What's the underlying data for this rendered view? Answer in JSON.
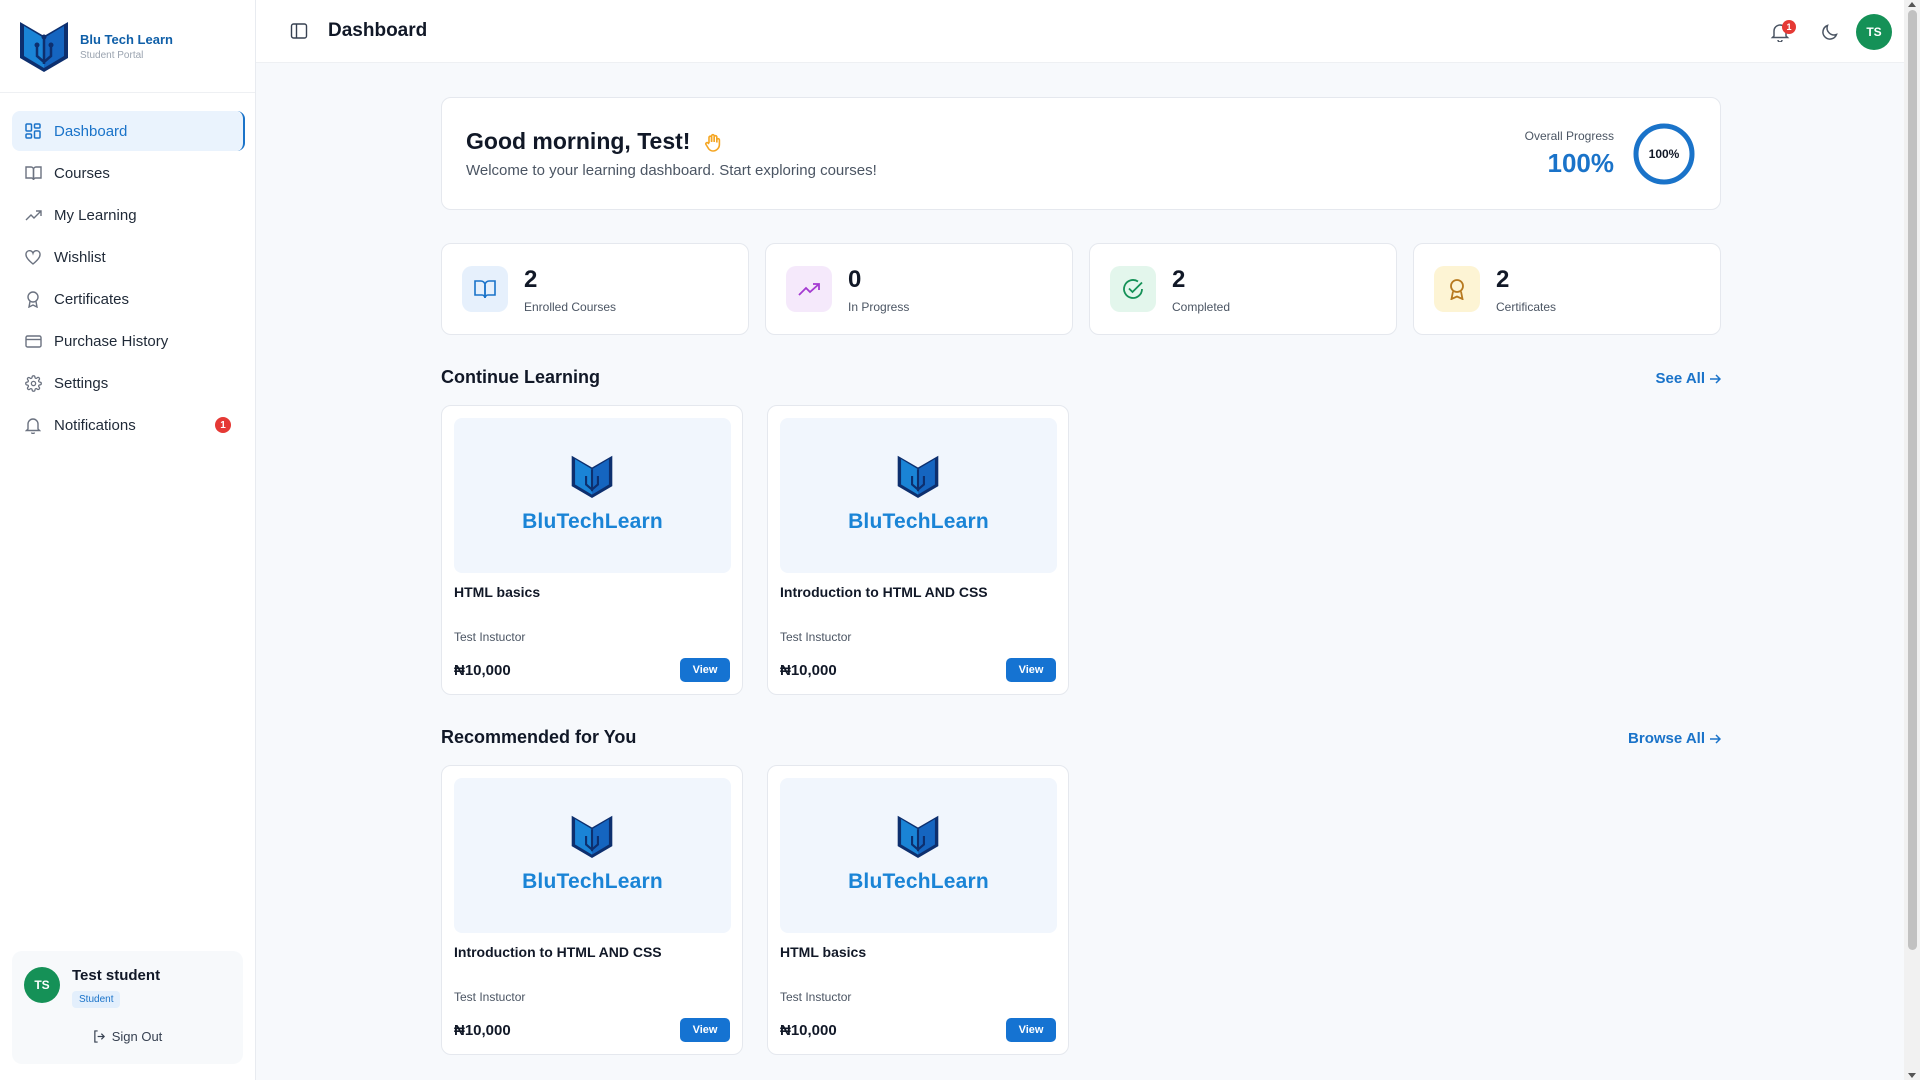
{
  "brand": {
    "name": "Blu Tech Learn",
    "subtitle": "Student Portal",
    "wordmark": "BluTechLearn"
  },
  "header": {
    "title": "Dashboard",
    "notification_count": "1",
    "avatar_initials": "TS"
  },
  "sidebar": {
    "items": [
      {
        "label": "Dashboard",
        "icon": "grid-icon",
        "active": true
      },
      {
        "label": "Courses",
        "icon": "book-icon"
      },
      {
        "label": "My Learning",
        "icon": "trend-icon"
      },
      {
        "label": "Wishlist",
        "icon": "heart-icon"
      },
      {
        "label": "Certificates",
        "icon": "award-icon"
      },
      {
        "label": "Purchase History",
        "icon": "card-icon"
      },
      {
        "label": "Settings",
        "icon": "gear-icon"
      },
      {
        "label": "Notifications",
        "icon": "bell-icon",
        "badge": "1"
      }
    ],
    "user": {
      "initials": "TS",
      "name": "Test student",
      "role": "Student",
      "signout": "Sign Out"
    }
  },
  "welcome": {
    "greeting": "Good morning, Test!",
    "subtitle": "Welcome to your learning dashboard. Start exploring courses!",
    "progress_label": "Overall Progress",
    "progress_value": "100%",
    "progress_fraction": 1.0
  },
  "stats": [
    {
      "value": "2",
      "label": "Enrolled Courses",
      "icon": "book-open-icon",
      "bg": "#e6f0fc",
      "color": "#1a73c9"
    },
    {
      "value": "0",
      "label": "In Progress",
      "icon": "trend-up-icon",
      "bg": "#f5e9fb",
      "color": "#a43ad1"
    },
    {
      "value": "2",
      "label": "Completed",
      "icon": "check-circle-icon",
      "bg": "#e3f6ec",
      "color": "#159157"
    },
    {
      "value": "2",
      "label": "Certificates",
      "icon": "award-icon",
      "bg": "#fdf4d4",
      "color": "#b7791f"
    }
  ],
  "continue": {
    "title": "Continue Learning",
    "link": "See All",
    "courses": [
      {
        "title": "HTML basics",
        "instructor": "Test Instuctor",
        "price": "₦10,000",
        "button": "View"
      },
      {
        "title": "Introduction to HTML AND CSS",
        "instructor": "Test Instuctor",
        "price": "₦10,000",
        "button": "View"
      }
    ]
  },
  "recommended": {
    "title": "Recommended for You",
    "link": "Browse All",
    "courses": [
      {
        "title": "Introduction to HTML AND CSS",
        "instructor": "Test Instuctor",
        "price": "₦10,000",
        "button": "View"
      },
      {
        "title": "HTML basics",
        "instructor": "Test Instuctor",
        "price": "₦10,000",
        "button": "View"
      }
    ]
  },
  "colors": {
    "accent": "#1a73c9",
    "avatar": "#159157",
    "badge": "#e53935",
    "wordmark": "#1a84d6"
  }
}
